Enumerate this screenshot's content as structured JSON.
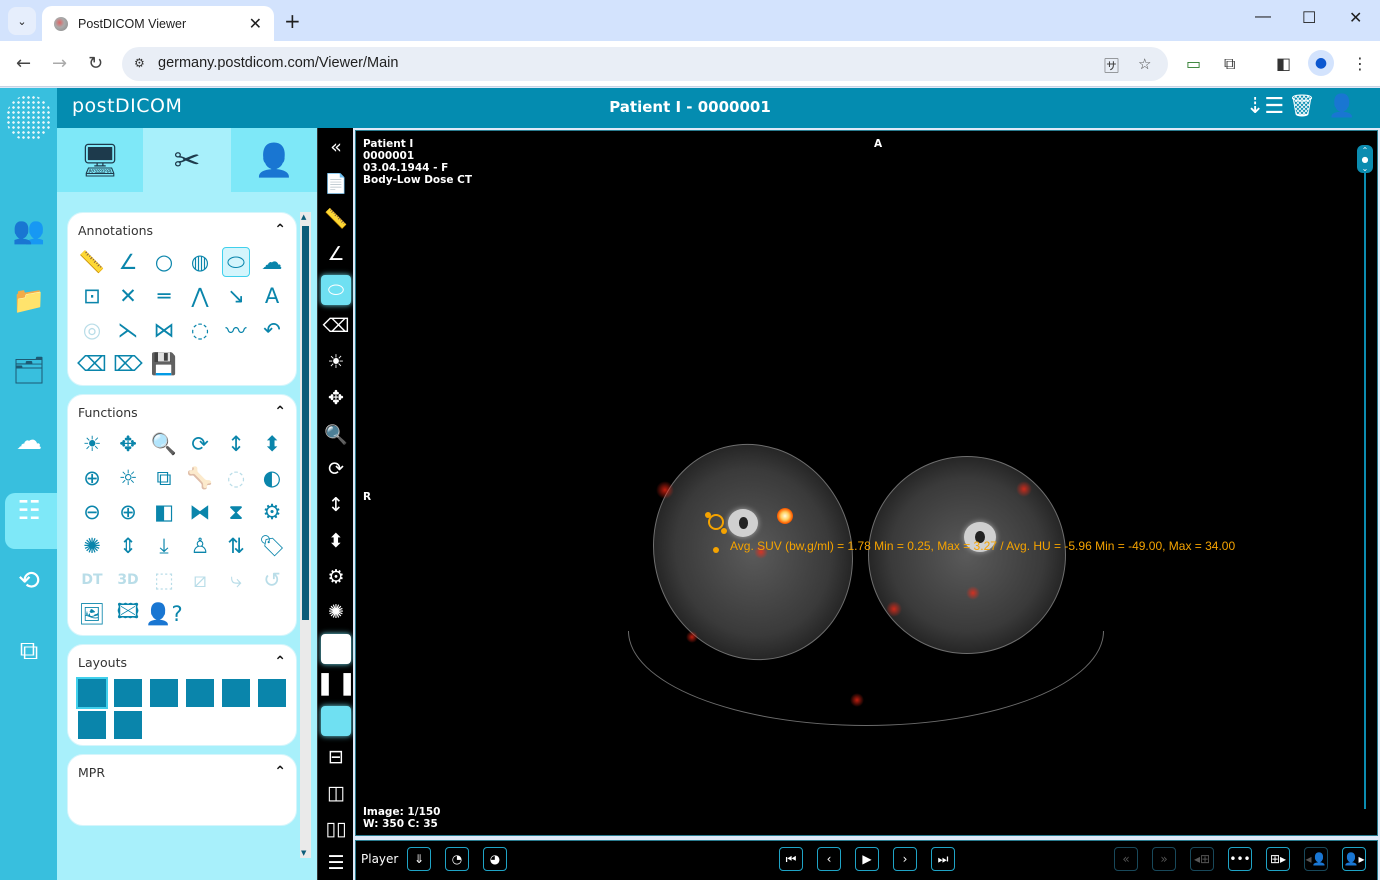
{
  "browser": {
    "tab_title": "PostDICOM Viewer",
    "url": "germany.postdicom.com/Viewer/Main",
    "new_tab": "+",
    "tab_close": "✕",
    "min": "—",
    "max": "☐",
    "close": "✕"
  },
  "app": {
    "brand": "postDICOM",
    "patient_title": "Patient I - 0000001"
  },
  "panel": {
    "tabs": [
      {
        "name": "viewer-tab",
        "icon": "monitor-icon"
      },
      {
        "name": "tools-tab",
        "icon": "tools-icon",
        "active": true
      },
      {
        "name": "info-tab",
        "icon": "patient-info-icon"
      }
    ],
    "sections": {
      "annotations": "Annotations",
      "functions": "Functions",
      "layouts": "Layouts",
      "mpr": "MPR"
    },
    "annotations": [
      {
        "name": "ruler",
        "glyph": "📏"
      },
      {
        "name": "angle",
        "glyph": "∠"
      },
      {
        "name": "circle",
        "glyph": "○"
      },
      {
        "name": "hatched-circle",
        "glyph": "◍"
      },
      {
        "name": "ellipse",
        "glyph": "⬭",
        "selected": true
      },
      {
        "name": "freehand-roi",
        "glyph": "☁"
      },
      {
        "name": "point-box",
        "glyph": "⊡"
      },
      {
        "name": "cross-lines",
        "glyph": "✕"
      },
      {
        "name": "parallel-lines",
        "glyph": "═"
      },
      {
        "name": "polyline",
        "glyph": "⋀"
      },
      {
        "name": "arrow",
        "glyph": "↘"
      },
      {
        "name": "text",
        "glyph": "A"
      },
      {
        "name": "target",
        "glyph": "◎",
        "dim": true
      },
      {
        "name": "cobb-angle",
        "glyph": "⋋"
      },
      {
        "name": "crossing-lines",
        "glyph": "⋈"
      },
      {
        "name": "closed-spline",
        "glyph": "◌"
      },
      {
        "name": "wave",
        "glyph": "〰"
      },
      {
        "name": "undo",
        "glyph": "↶"
      },
      {
        "name": "eraser",
        "glyph": "⌫"
      },
      {
        "name": "erase-all",
        "glyph": "⌦"
      },
      {
        "name": "save-annotations",
        "glyph": "💾"
      }
    ],
    "functions": [
      {
        "name": "window-level",
        "glyph": "☀"
      },
      {
        "name": "pan",
        "glyph": "✥"
      },
      {
        "name": "zoom",
        "glyph": "🔍"
      },
      {
        "name": "rotate",
        "glyph": "⟳"
      },
      {
        "name": "scroll-stack",
        "glyph": "↕"
      },
      {
        "name": "scroll-slab",
        "glyph": "⬍"
      },
      {
        "name": "crosshair",
        "glyph": "⊕"
      },
      {
        "name": "wl-preset",
        "glyph": "☼"
      },
      {
        "name": "copy-region",
        "glyph": "⧉"
      },
      {
        "name": "bone",
        "glyph": "🦴",
        "dim": true
      },
      {
        "name": "region",
        "glyph": "◌",
        "dim": true
      },
      {
        "name": "invert",
        "glyph": "◐"
      },
      {
        "name": "zoom-out",
        "glyph": "⊖"
      },
      {
        "name": "zoom-in",
        "glyph": "⊕"
      },
      {
        "name": "flip-horizontal",
        "glyph": "◧"
      },
      {
        "name": "flip-rotate-h",
        "glyph": "⧓"
      },
      {
        "name": "flip-rotate-v",
        "glyph": "⧗"
      },
      {
        "name": "rotate-settings",
        "glyph": "⚙"
      },
      {
        "name": "reset-settings",
        "glyph": "✺"
      },
      {
        "name": "expand-vertical",
        "glyph": "⇕"
      },
      {
        "name": "compress-vertical",
        "glyph": "⤓"
      },
      {
        "name": "patient-orientation",
        "glyph": "♙"
      },
      {
        "name": "swap",
        "glyph": "⇅"
      },
      {
        "name": "tag",
        "glyph": "🏷"
      },
      {
        "name": "dt",
        "glyph": "DT",
        "dim": true
      },
      {
        "name": "3d",
        "glyph": "3D",
        "dim": true
      },
      {
        "name": "bounding-box",
        "glyph": "⬚",
        "dim": true
      },
      {
        "name": "diagonal-box",
        "glyph": "⧄",
        "dim": true
      },
      {
        "name": "bone-rotate",
        "glyph": "⤷",
        "dim": true
      },
      {
        "name": "undo-region",
        "glyph": "↺",
        "dim": true
      },
      {
        "name": "download-image",
        "glyph": "🖼"
      },
      {
        "name": "save-image",
        "glyph": "🖾"
      },
      {
        "name": "help-person",
        "glyph": "👤?"
      }
    ],
    "layouts": [
      "1x1",
      "1x2",
      "1x3",
      "2x1",
      "2x2",
      "3x3",
      "1+2",
      "2+1"
    ]
  },
  "viewport": {
    "overlay_tl": [
      "Patient I",
      "0000001",
      "03.04.1944 - F",
      "Body-Low Dose CT"
    ],
    "orientation_top": "A",
    "orientation_left": "R",
    "image_counter": "Image: 1/150",
    "window": "W: 350 C: 35",
    "measurement": "Avg. SUV (bw,g/ml) = 1.78 Min = 0.25, Max = 3.27  / Avg. HU = -5.96 Min = -49.00, Max = 34.00",
    "accent": "#f5a300"
  },
  "player": {
    "label": "Player"
  },
  "colors": {
    "header": "#048cb0",
    "nav": "#38bfde",
    "panel": "#a8f0fb",
    "icon": "#0a85ab"
  }
}
